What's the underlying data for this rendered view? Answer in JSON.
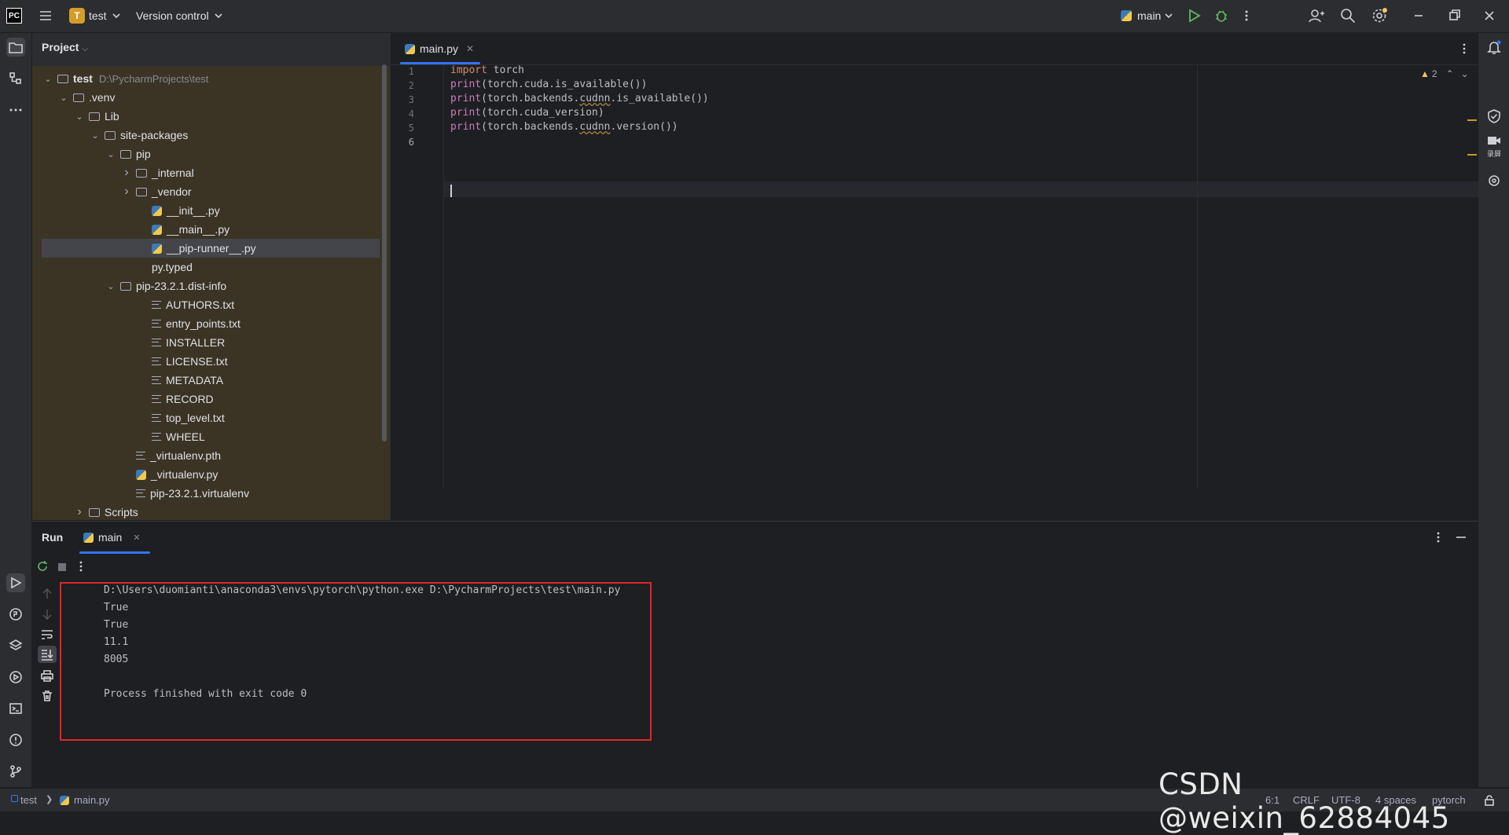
{
  "titlebar": {
    "logo": "PC",
    "project_badge": "T",
    "project_name": "test",
    "version_control": "Version control",
    "run_config": "main"
  },
  "project_panel": {
    "title": "Project",
    "tree": [
      {
        "label": "test",
        "sub": "D:\\PycharmProjects\\test",
        "indent": 0,
        "type": "folder",
        "expanded": true
      },
      {
        "label": ".venv",
        "indent": 1,
        "type": "folder",
        "expanded": true
      },
      {
        "label": "Lib",
        "indent": 2,
        "type": "folder",
        "expanded": true
      },
      {
        "label": "site-packages",
        "indent": 3,
        "type": "folder",
        "expanded": true
      },
      {
        "label": "pip",
        "indent": 4,
        "type": "folder",
        "expanded": true
      },
      {
        "label": "_internal",
        "indent": 5,
        "type": "folder",
        "expanded": false
      },
      {
        "label": "_vendor",
        "indent": 5,
        "type": "folder",
        "expanded": false
      },
      {
        "label": "__init__.py",
        "indent": 6,
        "type": "py"
      },
      {
        "label": "__main__.py",
        "indent": 6,
        "type": "py"
      },
      {
        "label": "__pip-runner__.py",
        "indent": 6,
        "type": "py",
        "selected": true
      },
      {
        "label": "py.typed",
        "indent": 6,
        "type": "none"
      },
      {
        "label": "pip-23.2.1.dist-info",
        "indent": 4,
        "type": "folder",
        "expanded": true
      },
      {
        "label": "AUTHORS.txt",
        "indent": 6,
        "type": "txt"
      },
      {
        "label": "entry_points.txt",
        "indent": 6,
        "type": "txt"
      },
      {
        "label": "INSTALLER",
        "indent": 6,
        "type": "txt"
      },
      {
        "label": "LICENSE.txt",
        "indent": 6,
        "type": "txt"
      },
      {
        "label": "METADATA",
        "indent": 6,
        "type": "txt"
      },
      {
        "label": "RECORD",
        "indent": 6,
        "type": "txt"
      },
      {
        "label": "top_level.txt",
        "indent": 6,
        "type": "txt"
      },
      {
        "label": "WHEEL",
        "indent": 6,
        "type": "txt"
      },
      {
        "label": "_virtualenv.pth",
        "indent": 5,
        "type": "txt"
      },
      {
        "label": "_virtualenv.py",
        "indent": 5,
        "type": "py"
      },
      {
        "label": "pip-23.2.1.virtualenv",
        "indent": 5,
        "type": "txt"
      },
      {
        "label": "Scripts",
        "indent": 2,
        "type": "folder",
        "expanded": false
      }
    ]
  },
  "editor": {
    "tab_label": "main.py",
    "warning_count": "2",
    "lines": [
      {
        "num": "1",
        "parts": [
          [
            "kw",
            "import"
          ],
          [
            "plain",
            " torch"
          ]
        ]
      },
      {
        "num": "2",
        "parts": [
          [
            "fn",
            "print"
          ],
          [
            "plain",
            "(torch.cuda.is_available())"
          ]
        ]
      },
      {
        "num": "3",
        "parts": [
          [
            "fn",
            "print"
          ],
          [
            "plain",
            "(torch.backends."
          ],
          [
            "wavy",
            "cudnn"
          ],
          [
            "plain",
            ".is_available())"
          ]
        ]
      },
      {
        "num": "4",
        "parts": [
          [
            "fn",
            "print"
          ],
          [
            "plain",
            "(torch.cuda_version)"
          ]
        ]
      },
      {
        "num": "5",
        "parts": [
          [
            "fn",
            "print"
          ],
          [
            "plain",
            "(torch.backends."
          ],
          [
            "wavy",
            "cudnn"
          ],
          [
            "plain",
            ".version())"
          ]
        ]
      },
      {
        "num": "6",
        "parts": []
      }
    ]
  },
  "run_panel": {
    "tab_run": "Run",
    "tab_main": "main",
    "console": [
      "D:\\Users\\duomianti\\anaconda3\\envs\\pytorch\\python.exe D:\\PycharmProjects\\test\\main.py",
      "True",
      "True",
      "11.1",
      "8005",
      "",
      "Process finished with exit code 0"
    ]
  },
  "statusbar": {
    "breadcrumb_project": "test",
    "breadcrumb_file": "main.py",
    "position": "6:1",
    "line_sep": "CRLF",
    "encoding": "UTF-8",
    "indent": "4 spaces",
    "interpreter": "pytorch"
  },
  "right_strip": {
    "record_label": "录屏"
  },
  "watermark": "CSDN @weixin_62884045",
  "colors": {
    "accent": "#3574f0",
    "highlight_box": "#e0252c",
    "run_green": "#5fb865",
    "warning": "#f2c55c"
  }
}
